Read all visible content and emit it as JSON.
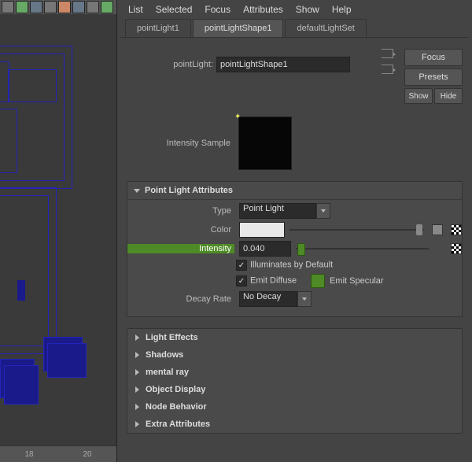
{
  "menu": {
    "list": "List",
    "selected": "Selected",
    "focus": "Focus",
    "attributes": "Attributes",
    "show": "Show",
    "help": "Help"
  },
  "tabs": [
    {
      "label": "pointLight1"
    },
    {
      "label": "pointLightShape1"
    },
    {
      "label": "defaultLightSet"
    }
  ],
  "active_tab": 1,
  "header": {
    "node_label": "pointLight:",
    "node_value": "pointLightShape1",
    "focus_btn": "Focus",
    "presets_btn": "Presets",
    "show_btn": "Show",
    "hide_btn": "Hide"
  },
  "sample": {
    "label": "Intensity Sample"
  },
  "section_title": "Point Light Attributes",
  "attrs": {
    "type_label": "Type",
    "type_value": "Point Light",
    "color_label": "Color",
    "color_value": "#e8e8e8",
    "intensity_label": "Intensity",
    "intensity_value": "0.040",
    "illum_label": "Illuminates by Default",
    "illum_checked": true,
    "diffuse_label": "Emit Diffuse",
    "diffuse_checked": true,
    "specular_label": "Emit Specular",
    "specular_checked": false,
    "decay_label": "Decay Rate",
    "decay_value": "No Decay"
  },
  "collapsed_sections": [
    "Light Effects",
    "Shadows",
    "mental ray",
    "Object Display",
    "Node Behavior",
    "Extra Attributes"
  ],
  "ruler": {
    "a": "18",
    "b": "20"
  }
}
